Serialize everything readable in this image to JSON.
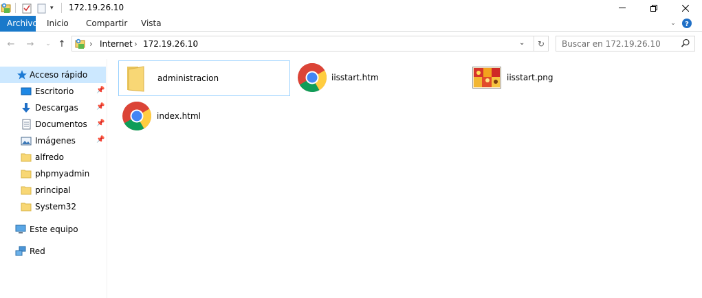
{
  "window": {
    "title": "172.19.26.10",
    "icons": [
      "properties-icon",
      "new-folder-icon",
      "customize-dropdown-icon",
      "minimize-icon",
      "maximize-icon",
      "close-icon"
    ]
  },
  "ribbon": {
    "tabs": [
      {
        "label": "Archivo",
        "active": true
      },
      {
        "label": "Inicio",
        "active": false
      },
      {
        "label": "Compartir",
        "active": false
      },
      {
        "label": "Vista",
        "active": false
      }
    ]
  },
  "address": {
    "breadcrumbs": [
      "Internet",
      "172.19.26.10"
    ]
  },
  "search": {
    "placeholder": "Buscar en 172.19.26.10"
  },
  "sidebar": {
    "items": [
      {
        "label": "Acceso rápido",
        "icon": "star-icon"
      },
      {
        "label": "Escritorio",
        "icon": "desktop-icon",
        "pinned": true
      },
      {
        "label": "Descargas",
        "icon": "download-arrow-icon",
        "pinned": true
      },
      {
        "label": "Documentos",
        "icon": "document-icon",
        "pinned": true
      },
      {
        "label": "Imágenes",
        "icon": "pictures-icon",
        "pinned": true
      },
      {
        "label": "alfredo",
        "icon": "folder-icon"
      },
      {
        "label": "phpmyadmin",
        "icon": "folder-icon"
      },
      {
        "label": "principal",
        "icon": "folder-icon"
      },
      {
        "label": "System32",
        "icon": "folder-icon"
      },
      {
        "label": "Este equipo",
        "icon": "computer-icon"
      },
      {
        "label": "Red",
        "icon": "network-icon"
      }
    ]
  },
  "files": [
    {
      "name": "administracion",
      "icon": "folder-icon"
    },
    {
      "name": "iisstart.htm",
      "icon": "chrome-icon"
    },
    {
      "name": "iisstart.png",
      "icon": "image-thumbnail-icon"
    },
    {
      "name": "index.html",
      "icon": "chrome-icon"
    }
  ],
  "colors": {
    "accent": "#1979ca",
    "selection": "#cce8ff",
    "folder": "#f8d775"
  }
}
